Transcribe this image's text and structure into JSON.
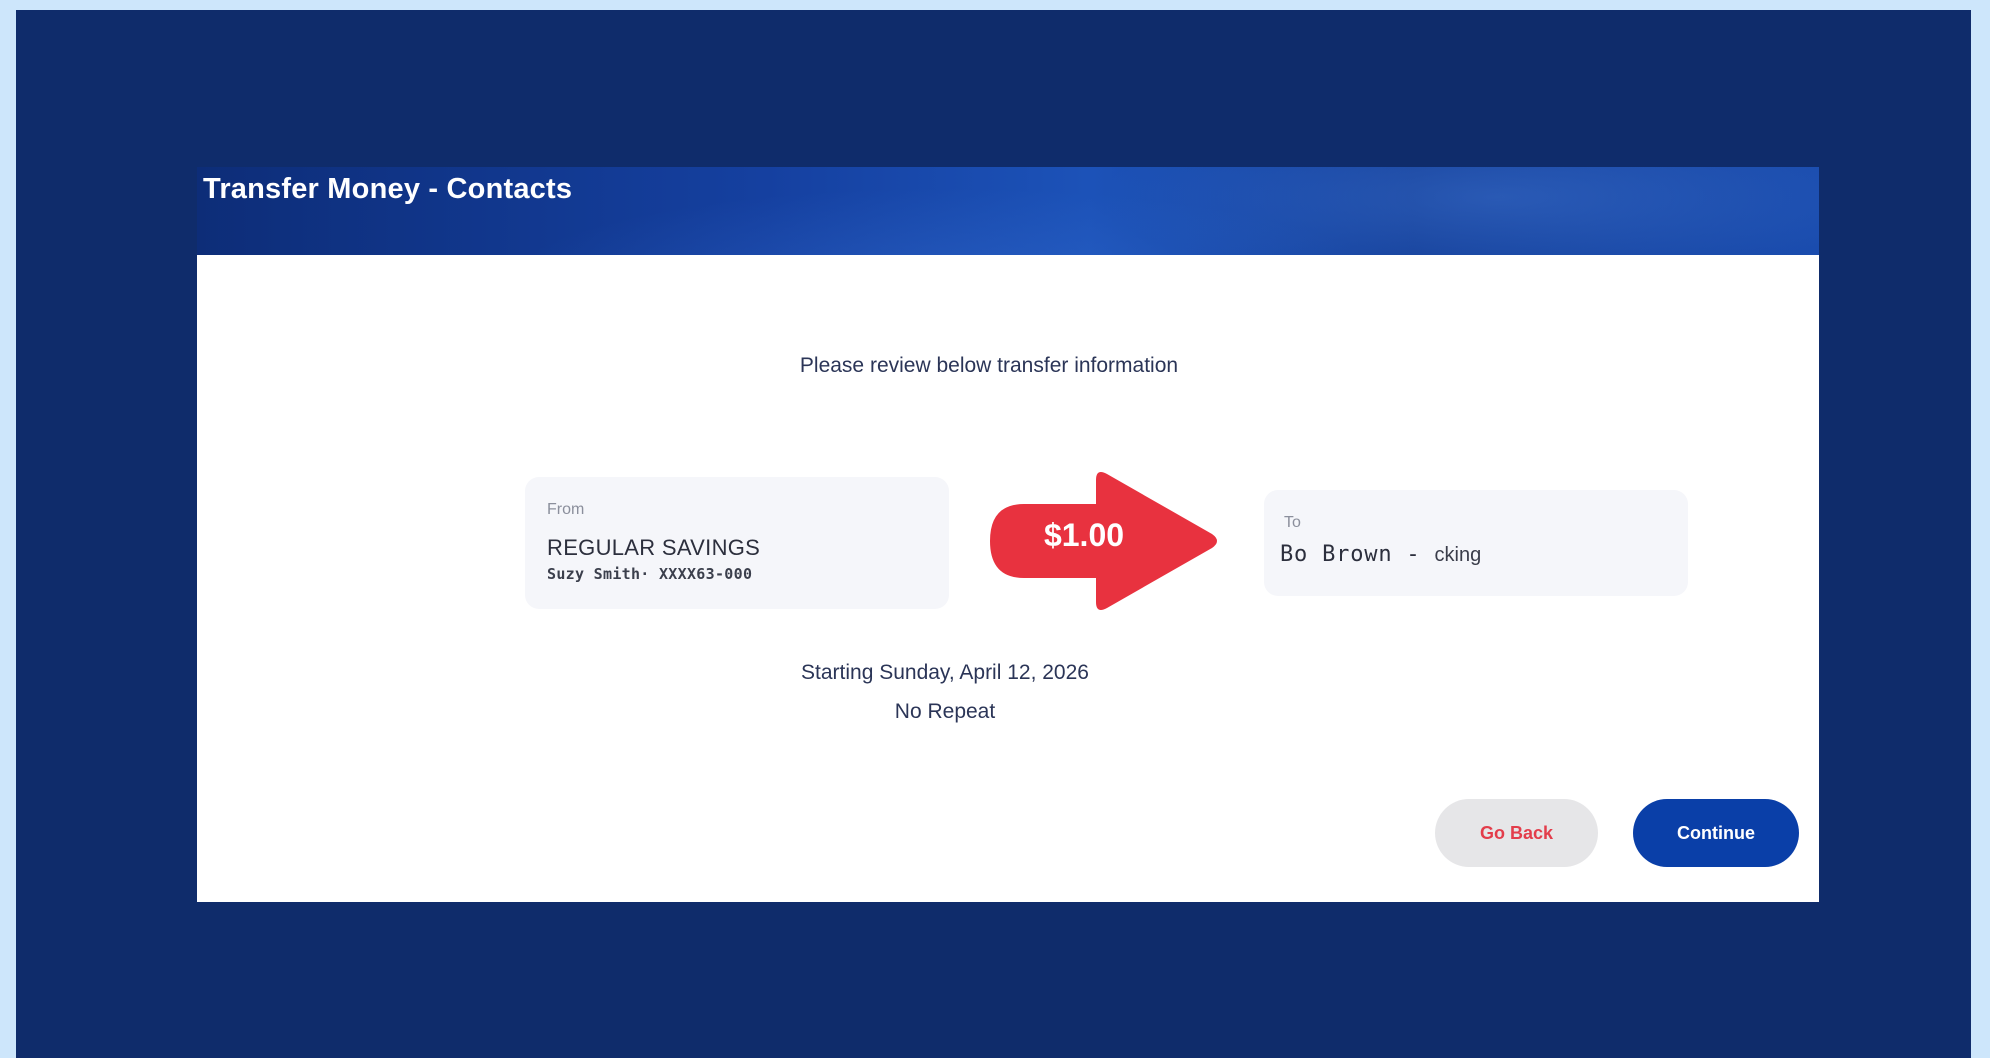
{
  "header": {
    "title": "Transfer Money - Contacts"
  },
  "review": {
    "instructions": "Please review below transfer information"
  },
  "from": {
    "label": "From",
    "account_name": "REGULAR SAVINGS",
    "account_detail": "Suzy Smith· XXXX63-000"
  },
  "transfer": {
    "amount": "$1.00"
  },
  "to": {
    "label": "To",
    "recipient_name": "Bo Brown -",
    "recipient_account": "cking"
  },
  "schedule": {
    "start": "Starting Sunday, April 12, 2026",
    "repeat": "No Repeat"
  },
  "actions": {
    "back_label": "Go Back",
    "continue_label": "Continue"
  },
  "colors": {
    "page_background": "#cde6fb",
    "frame_background": "#0f2c6b",
    "amount_arrow": "#e8323f",
    "primary_button": "#0a3fa8",
    "secondary_button_text": "#e33d4b"
  }
}
